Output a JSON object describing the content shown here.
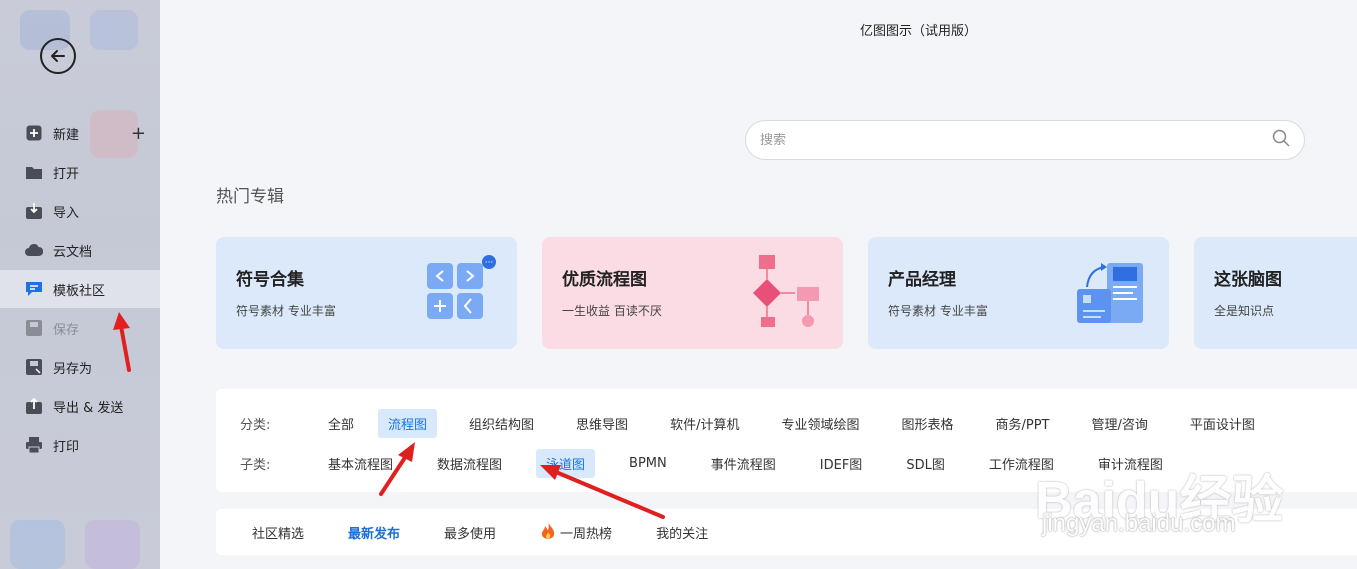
{
  "window": {
    "title": "亿图图示（试用版）"
  },
  "sidebar": {
    "items": [
      {
        "label": "新建",
        "icon": "plus-square-icon"
      },
      {
        "label": "打开",
        "icon": "folder-icon"
      },
      {
        "label": "导入",
        "icon": "import-icon"
      },
      {
        "label": "云文档",
        "icon": "cloud-icon"
      },
      {
        "label": "模板社区",
        "icon": "template-community-icon",
        "active": true
      },
      {
        "label": "保存",
        "icon": "save-icon",
        "disabled": true
      },
      {
        "label": "另存为",
        "icon": "save-as-icon"
      },
      {
        "label": "导出 & 发送",
        "icon": "export-icon"
      },
      {
        "label": "打印",
        "icon": "printer-icon"
      }
    ]
  },
  "search": {
    "placeholder": "搜索"
  },
  "hot": {
    "title": "热门专辑",
    "cards": [
      {
        "title": "符号合集",
        "subtitle": "符号素材 专业丰富",
        "bg": "#dce9fb"
      },
      {
        "title": "优质流程图",
        "subtitle": "一生收益 百读不厌",
        "bg": "#fcdce4"
      },
      {
        "title": "产品经理",
        "subtitle": "符号素材 专业丰富",
        "bg": "#dce9fb"
      },
      {
        "title": "这张脑图",
        "subtitle": "全是知识点",
        "bg": "#dce9fb"
      }
    ]
  },
  "filters": {
    "category_label": "分类:",
    "categories": [
      "全部",
      "流程图",
      "组织结构图",
      "思维导图",
      "软件/计算机",
      "专业领域绘图",
      "图形表格",
      "商务/PPT",
      "管理/咨询",
      "平面设计图"
    ],
    "category_active": "流程图",
    "sub_label": "子类:",
    "subcategories": [
      "基本流程图",
      "数据流程图",
      "泳道图",
      "BPMN",
      "事件流程图",
      "IDEF图",
      "SDL图",
      "工作流程图",
      "审计流程图"
    ],
    "sub_active": "泳道图"
  },
  "tabs": {
    "items": [
      "社区精选",
      "最新发布",
      "最多使用",
      "一周热榜",
      "我的关注"
    ],
    "active": "最新发布"
  },
  "watermark": {
    "main": "Baidu经验",
    "sub": "jingyan.baidu.com"
  },
  "colors": {
    "accent": "#1a73e8",
    "annotation": "#e02020"
  }
}
